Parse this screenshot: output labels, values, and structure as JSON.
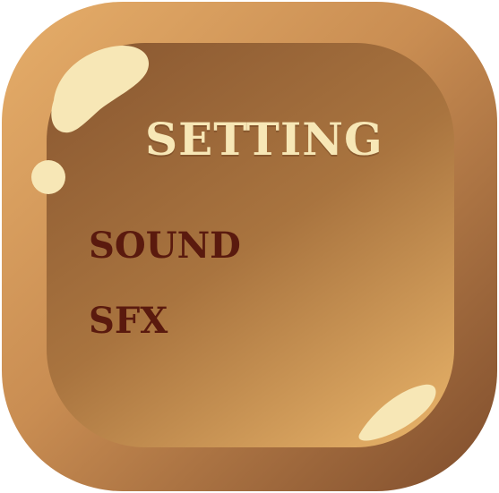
{
  "panel": {
    "title": "SETTING",
    "options": [
      {
        "label": "SOUND"
      },
      {
        "label": "SFX"
      }
    ]
  },
  "colors": {
    "outer_frame_light": "#e0a865",
    "outer_frame_dark": "#8a5530",
    "inner_panel_dark": "#8f5d34",
    "inner_panel_light": "#dba45f",
    "highlight": "#f7e7b6",
    "title_text": "#f7e7b6",
    "option_text": "#5a1a0e"
  }
}
